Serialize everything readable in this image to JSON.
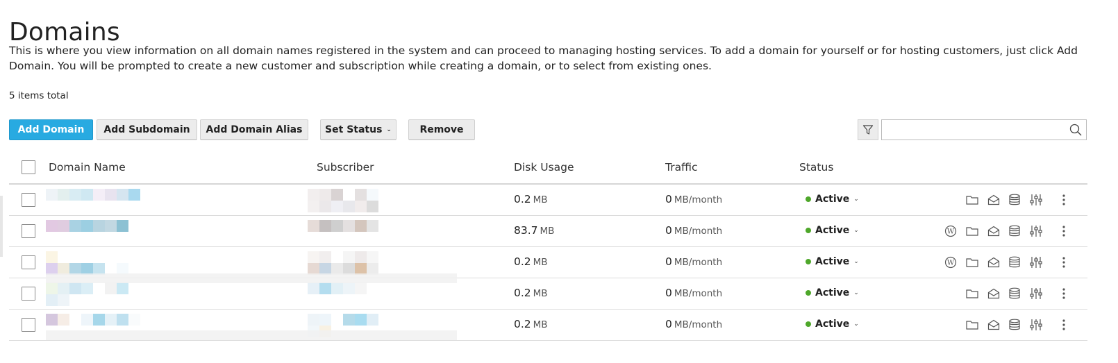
{
  "page": {
    "title": "Domains",
    "description": "This is where you view information on all domain names registered in the system and can proceed to managing hosting services. To add a domain for yourself or for hosting customers, just click Add Domain. You will be prompted to create a new customer and subscription while creating a domain, or to select from existing ones.",
    "items_total": "5 items total"
  },
  "toolbar": {
    "add_domain": "Add Domain",
    "add_subdomain": "Add Subdomain",
    "add_domain_alias": "Add Domain Alias",
    "set_status": "Set Status",
    "remove": "Remove",
    "search_placeholder": ""
  },
  "table": {
    "columns": [
      "Domain Name",
      "Subscriber",
      "Disk Usage",
      "Traffic",
      "Status"
    ],
    "rows": [
      {
        "disk": "0.2",
        "disk_unit": "MB",
        "traffic": "0",
        "traffic_unit": "MB/month",
        "status": "Active",
        "wordpress": false
      },
      {
        "disk": "83.7",
        "disk_unit": "MB",
        "traffic": "0",
        "traffic_unit": "MB/month",
        "status": "Active",
        "wordpress": true
      },
      {
        "disk": "0.2",
        "disk_unit": "MB",
        "traffic": "0",
        "traffic_unit": "MB/month",
        "status": "Active",
        "wordpress": true
      },
      {
        "disk": "0.2",
        "disk_unit": "MB",
        "traffic": "0",
        "traffic_unit": "MB/month",
        "status": "Active",
        "wordpress": false
      },
      {
        "disk": "0.2",
        "disk_unit": "MB",
        "traffic": "0",
        "traffic_unit": "MB/month",
        "status": "Active",
        "wordpress": false
      }
    ]
  },
  "colors": {
    "primary": "#28aae1",
    "active_dot": "#4ea72a"
  },
  "icons": [
    "filter-icon",
    "search-icon",
    "wordpress-icon",
    "folder-icon",
    "mail-icon",
    "database-icon",
    "settings-sliders-icon",
    "more-vertical-icon"
  ]
}
